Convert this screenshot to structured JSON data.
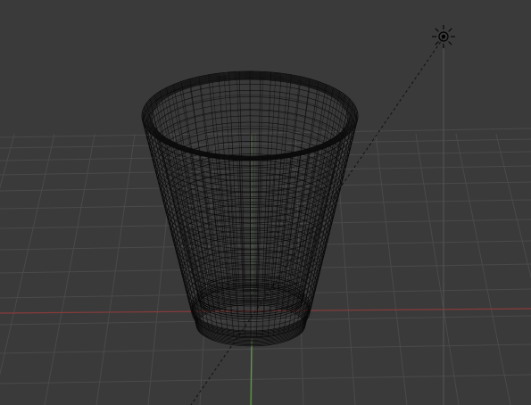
{
  "viewport": {
    "background": "#3a3a3a",
    "grid_color": "#4a4a4a",
    "x_axis_color": "#8a3a3a",
    "y_axis_color": "#5aa03a",
    "wire_color": "#0a0a0a",
    "light_line_color": "#111111"
  },
  "scene": {
    "object": {
      "name": "glass-tumbler",
      "display": "wireframe"
    },
    "light": {
      "icon": "sun-lamp-icon"
    }
  }
}
